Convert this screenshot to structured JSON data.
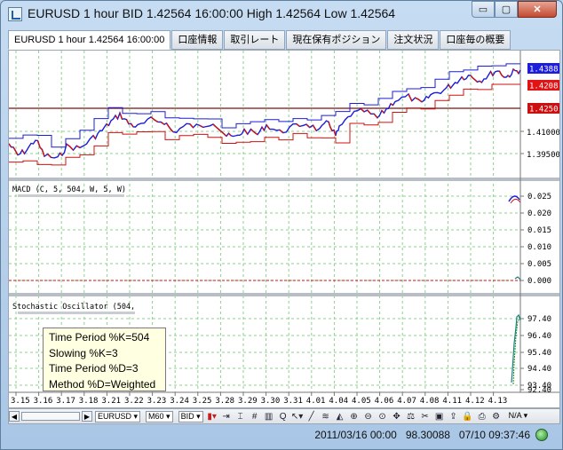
{
  "window": {
    "title": "EURUSD 1 hour BID 1.42564 16:00:00 High 1.42564 Low 1.42564",
    "minimize_label": "▭",
    "maximize_label": "▢",
    "close_label": "✕"
  },
  "tabs": [
    {
      "label": "EURUSD 1 hour 1.42564 16:00:00"
    },
    {
      "label": "口座情報"
    },
    {
      "label": "取引レート"
    },
    {
      "label": "現在保有ポジション"
    },
    {
      "label": "注文状況"
    },
    {
      "label": "口座毎の概要"
    }
  ],
  "colors": {
    "price": "#1c1cd8",
    "down": "#d01010",
    "grid": "#8fd08f",
    "current_price_bg": "#1d1de0",
    "red_tag_bg": "#e01414",
    "hline_tag_bg": "#cc1010"
  },
  "panels": {
    "price": {
      "price_tags": [
        "1.4388",
        "1.4208",
        "1.4250"
      ],
      "y_labels": [
        "1.41000",
        "1.39500"
      ]
    },
    "macd": {
      "label": "MACD (C, 5, 504, W, 5, W)",
      "y_labels": [
        "0.025",
        "0.020",
        "0.015",
        "0.010",
        "0.005",
        "0.000"
      ]
    },
    "stoch": {
      "label": "Stochastic Oscillator (504,",
      "y_labels": [
        "97.40",
        "96.40",
        "95.40",
        "94.40",
        "93.40",
        "92.40"
      ]
    }
  },
  "x_axis": [
    "3.15",
    "3.16",
    "3.17",
    "3.18",
    "3.21",
    "3.22",
    "3.23",
    "3.24",
    "3.25",
    "3.28",
    "3.29",
    "3.30",
    "3.31",
    "4.01",
    "4.04",
    "4.05",
    "4.06",
    "4.07",
    "4.08",
    "4.11",
    "4.12",
    "4.13"
  ],
  "tooltip": {
    "line1": "Time Period %K=504",
    "line2": "Slowing %K=3",
    "line3": "Time Period %D=3",
    "line4": "Method %D=Weighted"
  },
  "toolbar": {
    "symbol": "EURUSD ▾",
    "period": "M60 ▾",
    "side": "BID ▾",
    "na": "N/A ▾"
  },
  "status": {
    "datetime": "2011/03/16 00:00",
    "value": "98.30088",
    "clock": "07/10 09:37:46"
  }
}
